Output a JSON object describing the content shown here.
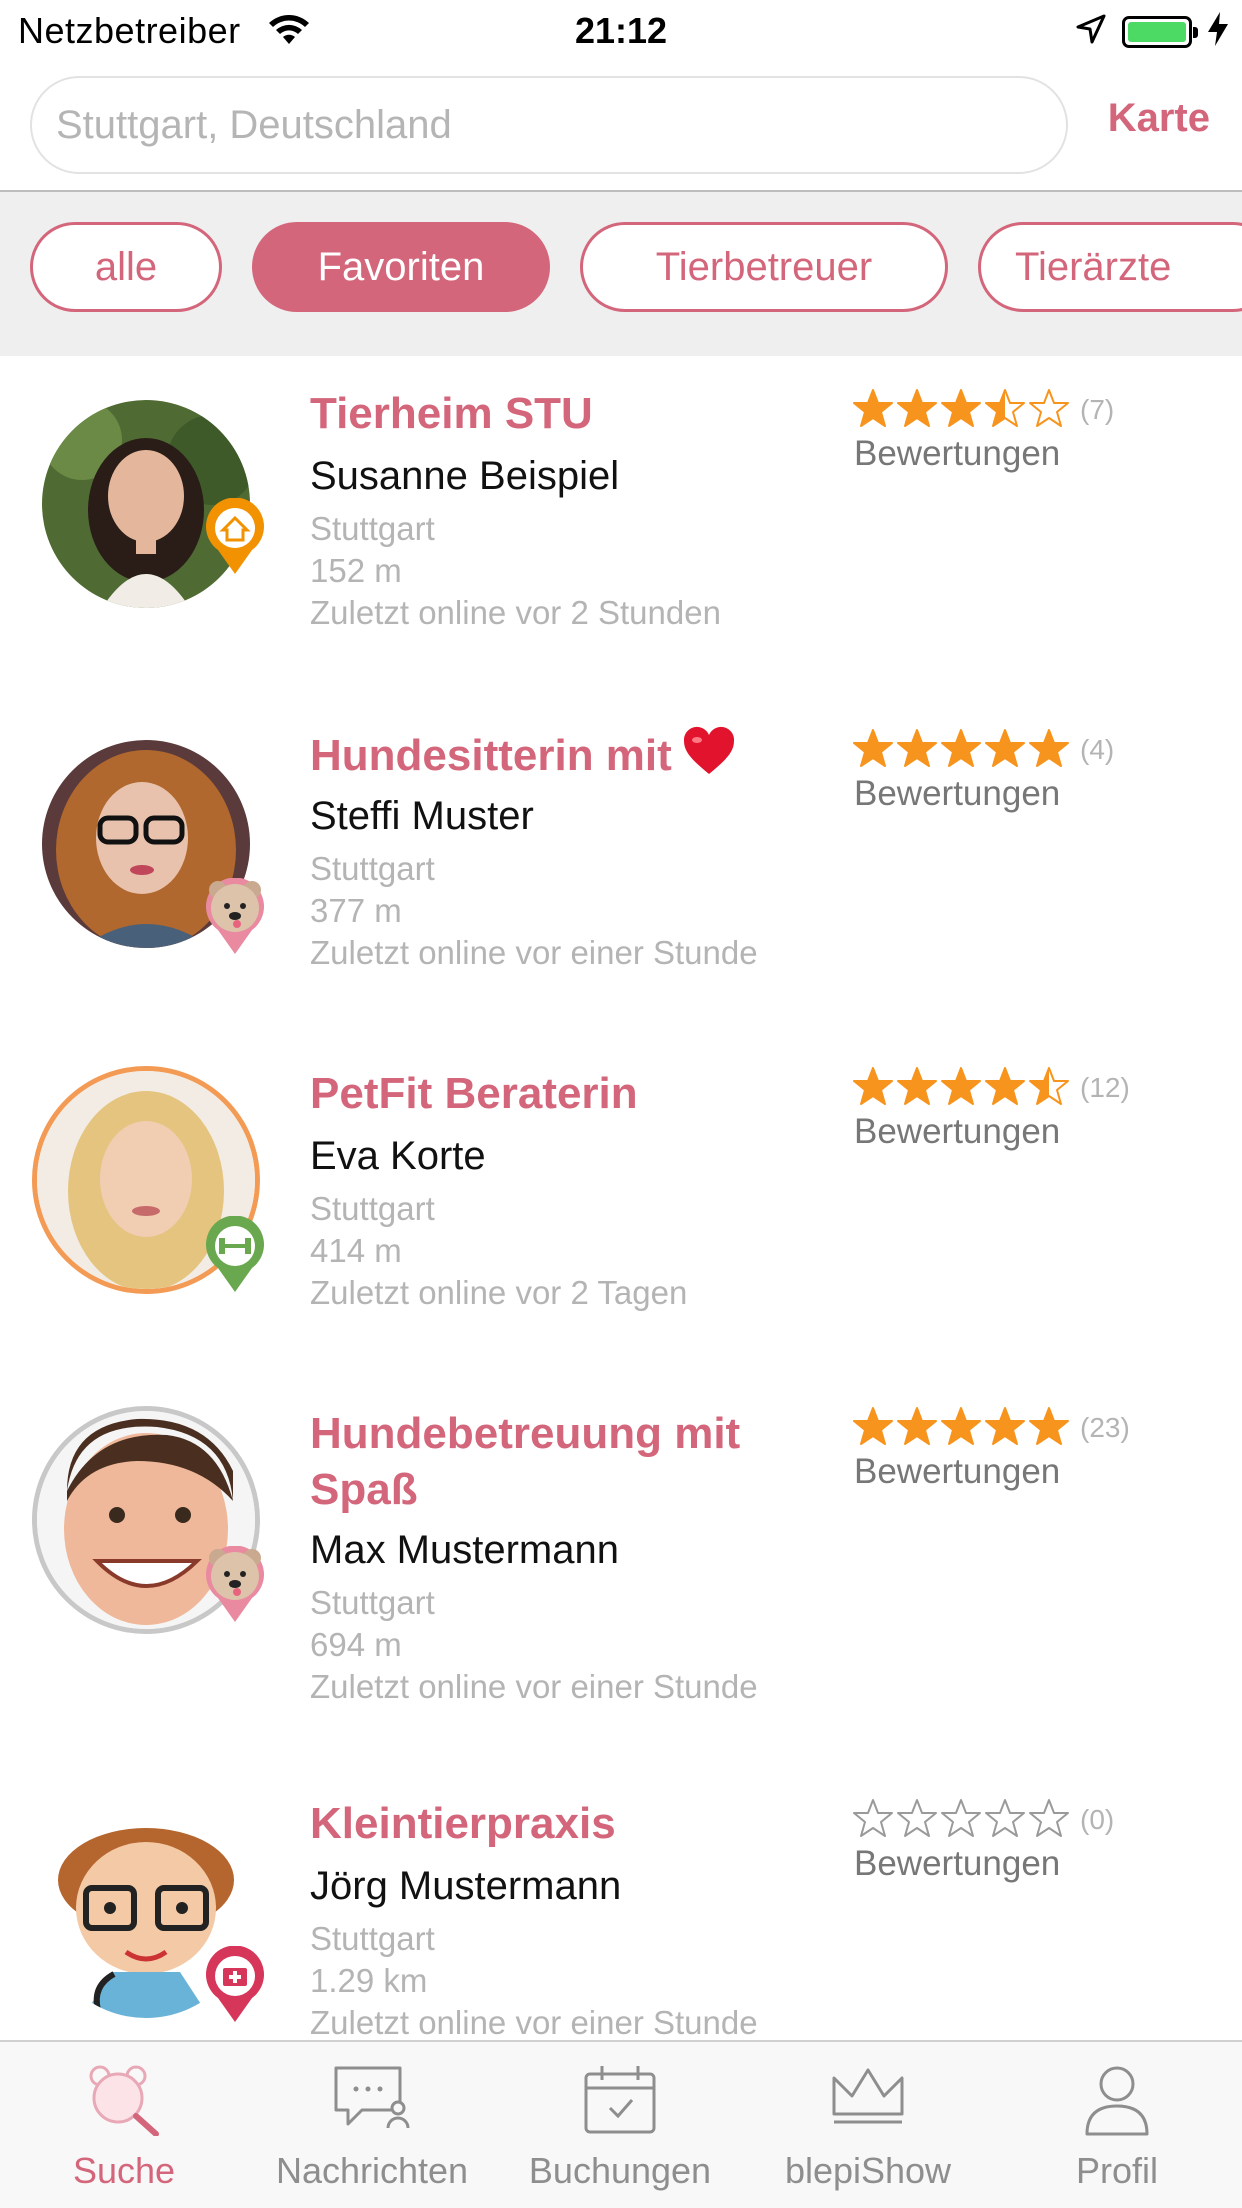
{
  "status_bar": {
    "carrier": "Netzbetreiber",
    "time": "21:12",
    "icons": [
      "wifi-icon",
      "location-arrow-icon",
      "battery-icon",
      "charging-bolt-icon"
    ]
  },
  "search": {
    "placeholder": "Stuttgart, Deutschland",
    "map_label": "Karte"
  },
  "filters": [
    {
      "label": "alle",
      "active": false
    },
    {
      "label": "Favoriten",
      "active": true
    },
    {
      "label": "Tierbetreuer",
      "active": false
    },
    {
      "label": "Tierärzte",
      "active": false
    }
  ],
  "colors": {
    "accent": "#d4667b",
    "star": "#f7941d",
    "meta": "#b4b4b4"
  },
  "results": [
    {
      "title": "Tierheim STU",
      "name": "Susanne Beispiel",
      "city": "Stuttgart",
      "distance": "152 m",
      "last_online": "Zuletzt online vor 2 Stunden",
      "rating": 3.5,
      "rating_count": "(7)",
      "rating_label": "Bewertungen",
      "badge": "shelter-house-icon"
    },
    {
      "title": "Hundesitterin mit",
      "name": "Steffi Muster",
      "city": "Stuttgart",
      "distance": "377 m",
      "last_online": "Zuletzt online vor einer Stunde",
      "rating": 5,
      "rating_count": "(4)",
      "rating_label": "Bewertungen",
      "badge": "pet-sitter-bear-icon"
    },
    {
      "title": "PetFit Beraterin",
      "name": "Eva Korte",
      "city": "Stuttgart",
      "distance": "414 m",
      "last_online": "Zuletzt online vor 2 Tagen",
      "rating": 4.5,
      "rating_count": "(12)",
      "rating_label": "Bewertungen",
      "badge": "fitness-dumbbell-icon"
    },
    {
      "title": "Hundebetreuung mit Spaß",
      "name": "Max Mustermann",
      "city": "Stuttgart",
      "distance": "694 m",
      "last_online": "Zuletzt online vor einer Stunde",
      "rating": 5,
      "rating_count": "(23)",
      "rating_label": "Bewertungen",
      "badge": "pet-sitter-bear-icon"
    },
    {
      "title": "Kleintierpraxis",
      "name": "Jörg Mustermann",
      "city": "Stuttgart",
      "distance": "1.29 km",
      "last_online": "Zuletzt online vor einer Stunde",
      "rating": 0,
      "rating_count": "(0)",
      "rating_label": "Bewertungen",
      "badge": "vet-medical-icon"
    }
  ],
  "tabs": [
    {
      "label": "Suche",
      "icon": "search-bear-icon",
      "active": true
    },
    {
      "label": "Nachrichten",
      "icon": "chat-icon",
      "active": false
    },
    {
      "label": "Buchungen",
      "icon": "calendar-icon",
      "active": false
    },
    {
      "label": "blepiShow",
      "icon": "crown-icon",
      "active": false
    },
    {
      "label": "Profil",
      "icon": "person-icon",
      "active": false
    }
  ]
}
